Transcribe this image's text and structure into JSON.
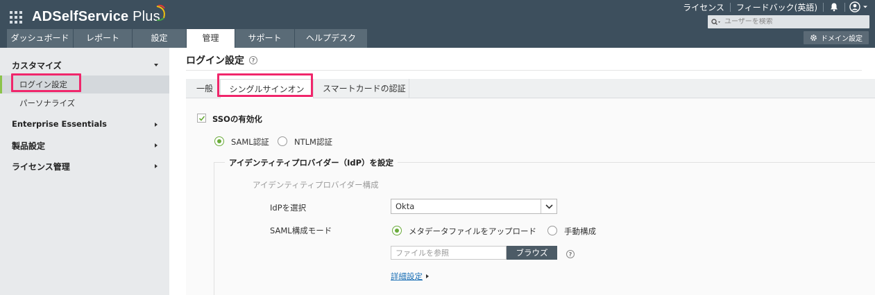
{
  "app": {
    "name": "ADSelfService",
    "name_suffix": "Plus"
  },
  "header": {
    "links": {
      "license": "ライセンス",
      "feedback": "フィードバック(英語)"
    },
    "search_placeholder": "ユーザーを検索",
    "domain_button": "ドメイン設定"
  },
  "nav": {
    "tabs": [
      {
        "label": "ダッシュボード"
      },
      {
        "label": "レポート"
      },
      {
        "label": "設定"
      },
      {
        "label": "管理",
        "active": true
      },
      {
        "label": "サポート"
      },
      {
        "label": "ヘルプデスク"
      }
    ]
  },
  "sidebar": {
    "customize": "カスタマイズ",
    "login_settings": "ログイン設定",
    "personalize": "パーソナライズ",
    "enterprise": "Enterprise Essentials",
    "product_settings": "製品設定",
    "license_mgmt": "ライセンス管理"
  },
  "main": {
    "title": "ログイン設定",
    "help": "?",
    "subtabs": {
      "general": "一般",
      "sso": "シングルサインオン",
      "smartcard": "スマートカードの認証"
    },
    "enable_sso": "SSOの有効化",
    "auth": {
      "saml": "SAML認証",
      "ntlm": "NTLM認証"
    },
    "idp_legend": "アイデンティティプロバイダー（IdP）を設定",
    "idp_config": "アイデンティティプロバイダー構成",
    "select_idp_label": "IdPを選択",
    "select_idp_value": "Okta",
    "saml_mode_label": "SAML構成モード",
    "saml_mode": {
      "upload": "メタデータファイルをアップロード",
      "manual": "手動構成"
    },
    "file_placeholder": "ファイルを参照",
    "browse": "ブラウズ",
    "advanced": "詳細設定"
  },
  "colors": {
    "header": "#3d4f5d",
    "accent_green": "#6aab3b",
    "highlight": "#f0266b",
    "link": "#1a6fb5"
  }
}
